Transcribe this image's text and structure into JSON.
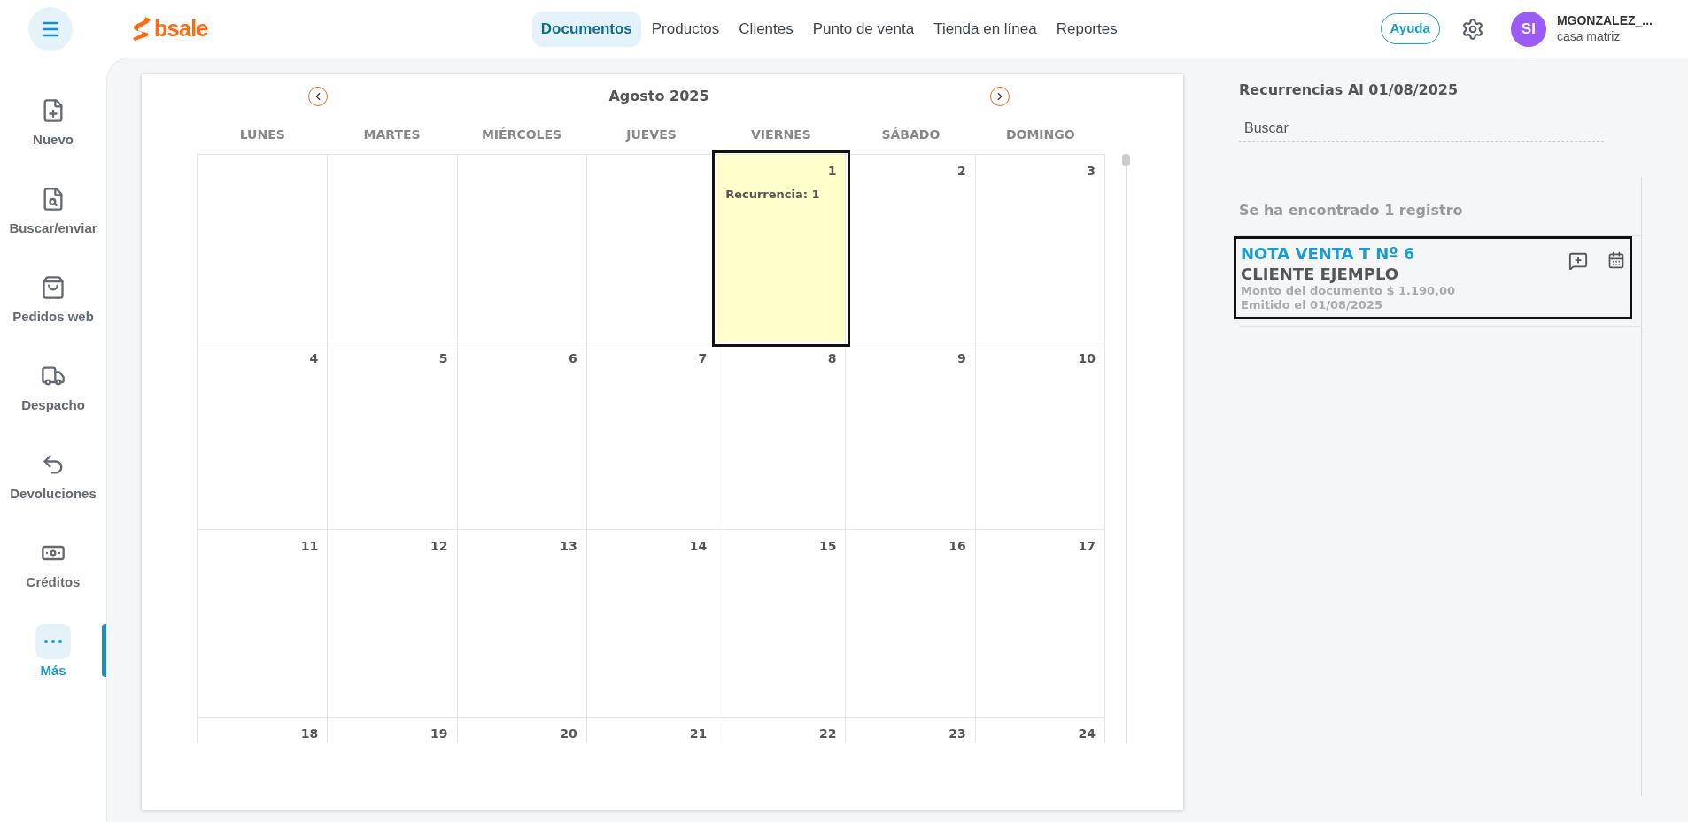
{
  "header": {
    "logo": "bsale",
    "nav": [
      {
        "label": "Documentos",
        "selected": true
      },
      {
        "label": "Productos",
        "selected": false
      },
      {
        "label": "Clientes",
        "selected": false
      },
      {
        "label": "Punto de venta",
        "selected": false
      },
      {
        "label": "Tienda en línea",
        "selected": false
      },
      {
        "label": "Reportes",
        "selected": false
      }
    ],
    "help_button": "Ayuda",
    "user": {
      "initials": "SI",
      "name": "MGONZALEZ_...",
      "branch": "casa matriz"
    }
  },
  "sidebar": {
    "items": [
      {
        "label": "Nuevo",
        "selected": false
      },
      {
        "label": "Buscar/enviar",
        "selected": false
      },
      {
        "label": "Pedidos web",
        "selected": false
      },
      {
        "label": "Despacho",
        "selected": false
      },
      {
        "label": "Devoluciones",
        "selected": false
      },
      {
        "label": "Créditos",
        "selected": false
      },
      {
        "label": "Más",
        "selected": true
      }
    ]
  },
  "calendar": {
    "month": "Agosto 2025",
    "weekdays": [
      "LUNES",
      "MARTES",
      "MIÉRCOLES",
      "JUEVES",
      "VIERNES",
      "SÁBADO",
      "DOMINGO"
    ],
    "weeks": [
      [
        {
          "kind": "blank"
        },
        {
          "kind": "blank"
        },
        {
          "kind": "blank"
        },
        {
          "kind": "blank"
        },
        {
          "kind": "day",
          "day": "1",
          "selected": true,
          "events": [
            "Recurrencia: 1"
          ]
        },
        {
          "kind": "day",
          "day": "2",
          "selected": false
        },
        {
          "kind": "day",
          "day": "3",
          "selected": false
        }
      ],
      [
        {
          "kind": "day",
          "day": "4",
          "selected": false
        },
        {
          "kind": "day",
          "day": "5",
          "selected": false
        },
        {
          "kind": "day",
          "day": "6",
          "selected": false
        },
        {
          "kind": "day",
          "day": "7",
          "selected": false
        },
        {
          "kind": "day",
          "day": "8",
          "selected": false
        },
        {
          "kind": "day",
          "day": "9",
          "selected": false
        },
        {
          "kind": "day",
          "day": "10",
          "selected": false
        }
      ],
      [
        {
          "kind": "day",
          "day": "11",
          "selected": false
        },
        {
          "kind": "day",
          "day": "12",
          "selected": false
        },
        {
          "kind": "day",
          "day": "13",
          "selected": false
        },
        {
          "kind": "day",
          "day": "14",
          "selected": false
        },
        {
          "kind": "day",
          "day": "15",
          "selected": false
        },
        {
          "kind": "day",
          "day": "16",
          "selected": false
        },
        {
          "kind": "day",
          "day": "17",
          "selected": false
        }
      ],
      [
        {
          "kind": "day",
          "day": "18",
          "selected": false
        },
        {
          "kind": "day",
          "day": "19",
          "selected": false
        },
        {
          "kind": "day",
          "day": "20",
          "selected": false
        },
        {
          "kind": "day",
          "day": "21",
          "selected": false
        },
        {
          "kind": "day",
          "day": "22",
          "selected": false
        },
        {
          "kind": "day",
          "day": "23",
          "selected": false
        },
        {
          "kind": "day",
          "day": "24",
          "selected": false
        }
      ]
    ]
  },
  "recurrences": {
    "title": "Recurrencias Al 01/08/2025",
    "search": {
      "placeholder": "Buscar"
    },
    "result_count": "Se ha encontrado 1 registro",
    "records": [
      {
        "title": "NOTA VENTA T Nº 6",
        "client": "CLIENTE EJEMPLO",
        "amount": "Monto del documento $ 1.190,00",
        "issued": "Emitido el 01/08/2025",
        "selected": true
      }
    ]
  }
}
